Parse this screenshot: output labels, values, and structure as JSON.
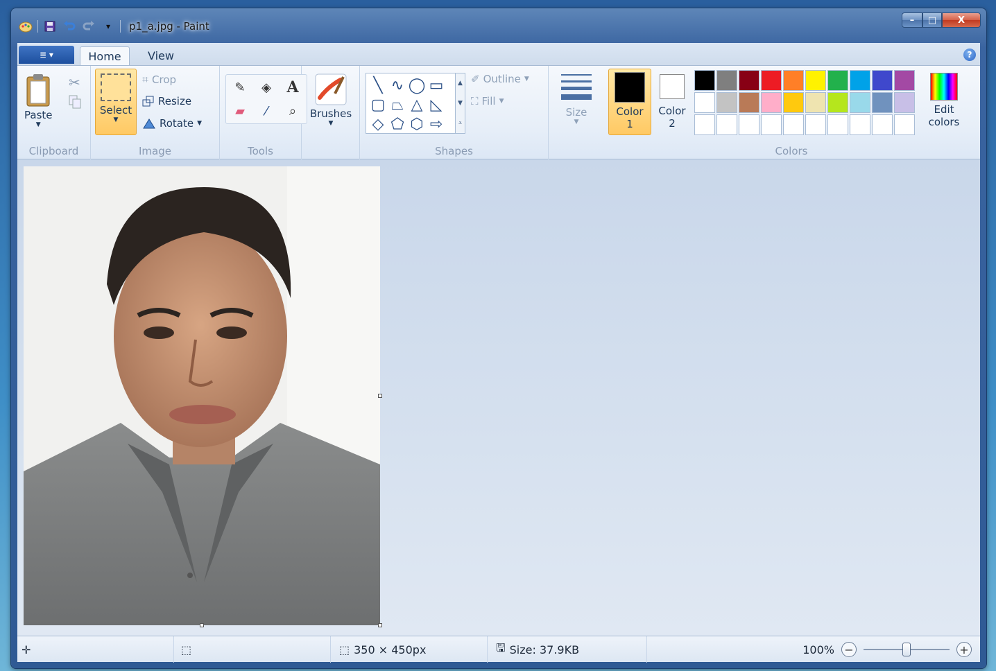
{
  "window": {
    "title": "p1_a.jpg - Paint",
    "buttons": {
      "minimize": "–",
      "maximize": "□",
      "close": "X"
    }
  },
  "quick_access": {
    "customize_label": "▾"
  },
  "tabs": {
    "menu_glyph": "≣ ▾",
    "home": "Home",
    "view": "View",
    "help": "?"
  },
  "ribbon": {
    "clipboard": {
      "label": "Clipboard",
      "paste": "Paste"
    },
    "image": {
      "label": "Image",
      "select": "Select",
      "crop": "Crop",
      "resize": "Resize",
      "rotate": "Rotate"
    },
    "tools": {
      "label": "Tools"
    },
    "brushes": {
      "label": "Brushes"
    },
    "shapes": {
      "label": "Shapes",
      "outline": "Outline",
      "fill": "Fill"
    },
    "size": {
      "label": "Size"
    },
    "colors": {
      "label": "Colors",
      "color1_line1": "Color",
      "color1_line2": "1",
      "color2_line1": "Color",
      "color2_line2": "2",
      "edit_line1": "Edit",
      "edit_line2": "colors",
      "color1_value": "#000000",
      "color2_value": "#ffffff",
      "palette_row1": [
        "#000000",
        "#7f7f7f",
        "#880015",
        "#ed1c24",
        "#ff7f27",
        "#fff200",
        "#22b14c",
        "#00a2e8",
        "#3f48cc",
        "#a349a4"
      ],
      "palette_row2": [
        "#ffffff",
        "#c3c3c3",
        "#b97a57",
        "#ffaec9",
        "#ffc90e",
        "#efe4b0",
        "#b5e61d",
        "#99d9ea",
        "#7092be",
        "#c8bfe7"
      ],
      "palette_row3": [
        "#ffffff",
        "#ffffff",
        "#ffffff",
        "#ffffff",
        "#ffffff",
        "#ffffff",
        "#ffffff",
        "#ffffff",
        "#ffffff",
        "#ffffff"
      ]
    }
  },
  "status": {
    "dimensions": "350 × 450px",
    "filesize": "Size: 37.9KB",
    "zoom": "100%",
    "zoom_level_fraction": 0.5
  }
}
